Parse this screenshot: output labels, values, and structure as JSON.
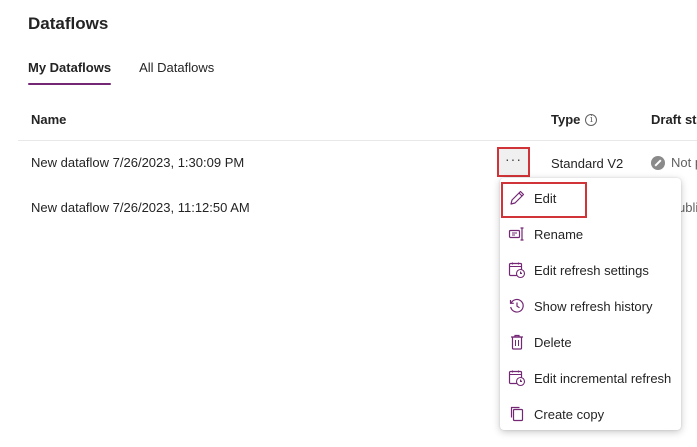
{
  "page": {
    "title": "Dataflows"
  },
  "tabs": [
    {
      "label": "My Dataflows",
      "active": true
    },
    {
      "label": "All Dataflows",
      "active": false
    }
  ],
  "table": {
    "columns": {
      "name": "Name",
      "type": "Type",
      "draft": "Draft sta"
    },
    "rows": [
      {
        "name": "New dataflow 7/26/2023, 1:30:09 PM",
        "type": "Standard V2",
        "draft": "Not p"
      },
      {
        "name": "New dataflow 7/26/2023, 11:12:50 AM",
        "type": "",
        "draft": "ubli"
      }
    ]
  },
  "more_button": {
    "label": "···"
  },
  "menu": {
    "items": [
      {
        "label": "Edit",
        "icon": "pencil-icon"
      },
      {
        "label": "Rename",
        "icon": "rename-icon"
      },
      {
        "label": "Edit refresh settings",
        "icon": "calendar-clock-icon"
      },
      {
        "label": "Show refresh history",
        "icon": "history-icon"
      },
      {
        "label": "Delete",
        "icon": "trash-icon"
      },
      {
        "label": "Edit incremental refresh",
        "icon": "calendar-clock-icon"
      },
      {
        "label": "Create copy",
        "icon": "copy-icon"
      }
    ]
  },
  "colors": {
    "accent": "#742774",
    "highlight": "#d13438"
  }
}
